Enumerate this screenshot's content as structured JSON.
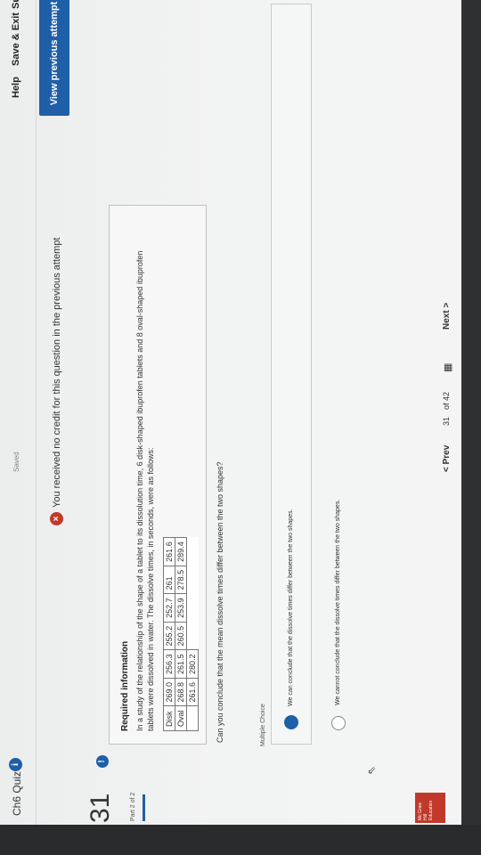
{
  "header": {
    "quiz_title": "Ch6 Quiz",
    "info_icon": "info-icon",
    "saved_text": "Saved",
    "help_label": "Help",
    "save_exit_label": "Save & Exit",
    "submit_label": "Subr"
  },
  "notice": {
    "icon": "error-x-icon",
    "text": "You received no credit for this question in the previous attempt"
  },
  "view_previous_label": "View previous attempt",
  "question": {
    "number": "31",
    "part": "Part 2 of 2",
    "badge": "!",
    "required_heading": "Required information",
    "required_text": "In a study of the relationship of the shape of a tablet to its dissolution time, 6 disk-shaped ibuprofen tablets and 8 oval-shaped ibuprofen tablets were dissolved in water. The dissolve times, in seconds, were as follows:",
    "table": [
      [
        "Disk",
        "269.0",
        "256.3",
        "255.2",
        "252.7",
        "261",
        "261.6"
      ],
      [
        "Oval",
        "268.8",
        "261.5",
        "260.5",
        "253.9",
        "278.5",
        "289.4"
      ],
      [
        "",
        "261.6",
        "280.2",
        "",
        "",
        "",
        ""
      ]
    ],
    "prompt": "Can you conclude that the mean dissolve times differ between the two shapes?",
    "mc_label": "Multiple Choice",
    "choices": [
      {
        "text": "We can conclude that the dissolve times differ between the two shapes.",
        "selected": true
      },
      {
        "text": "We cannot conclude that the dissolve times differ between the two shapes.",
        "selected": false
      }
    ]
  },
  "pager": {
    "prev_label": "< Prev",
    "current": "31",
    "of_text": "of 42",
    "grid_icon": "grid-icon",
    "next_label": "Next >"
  },
  "logo_text": "Mc Graw Hill Education",
  "colors": {
    "accent": "#1f5fa8",
    "error": "#c0392b"
  }
}
